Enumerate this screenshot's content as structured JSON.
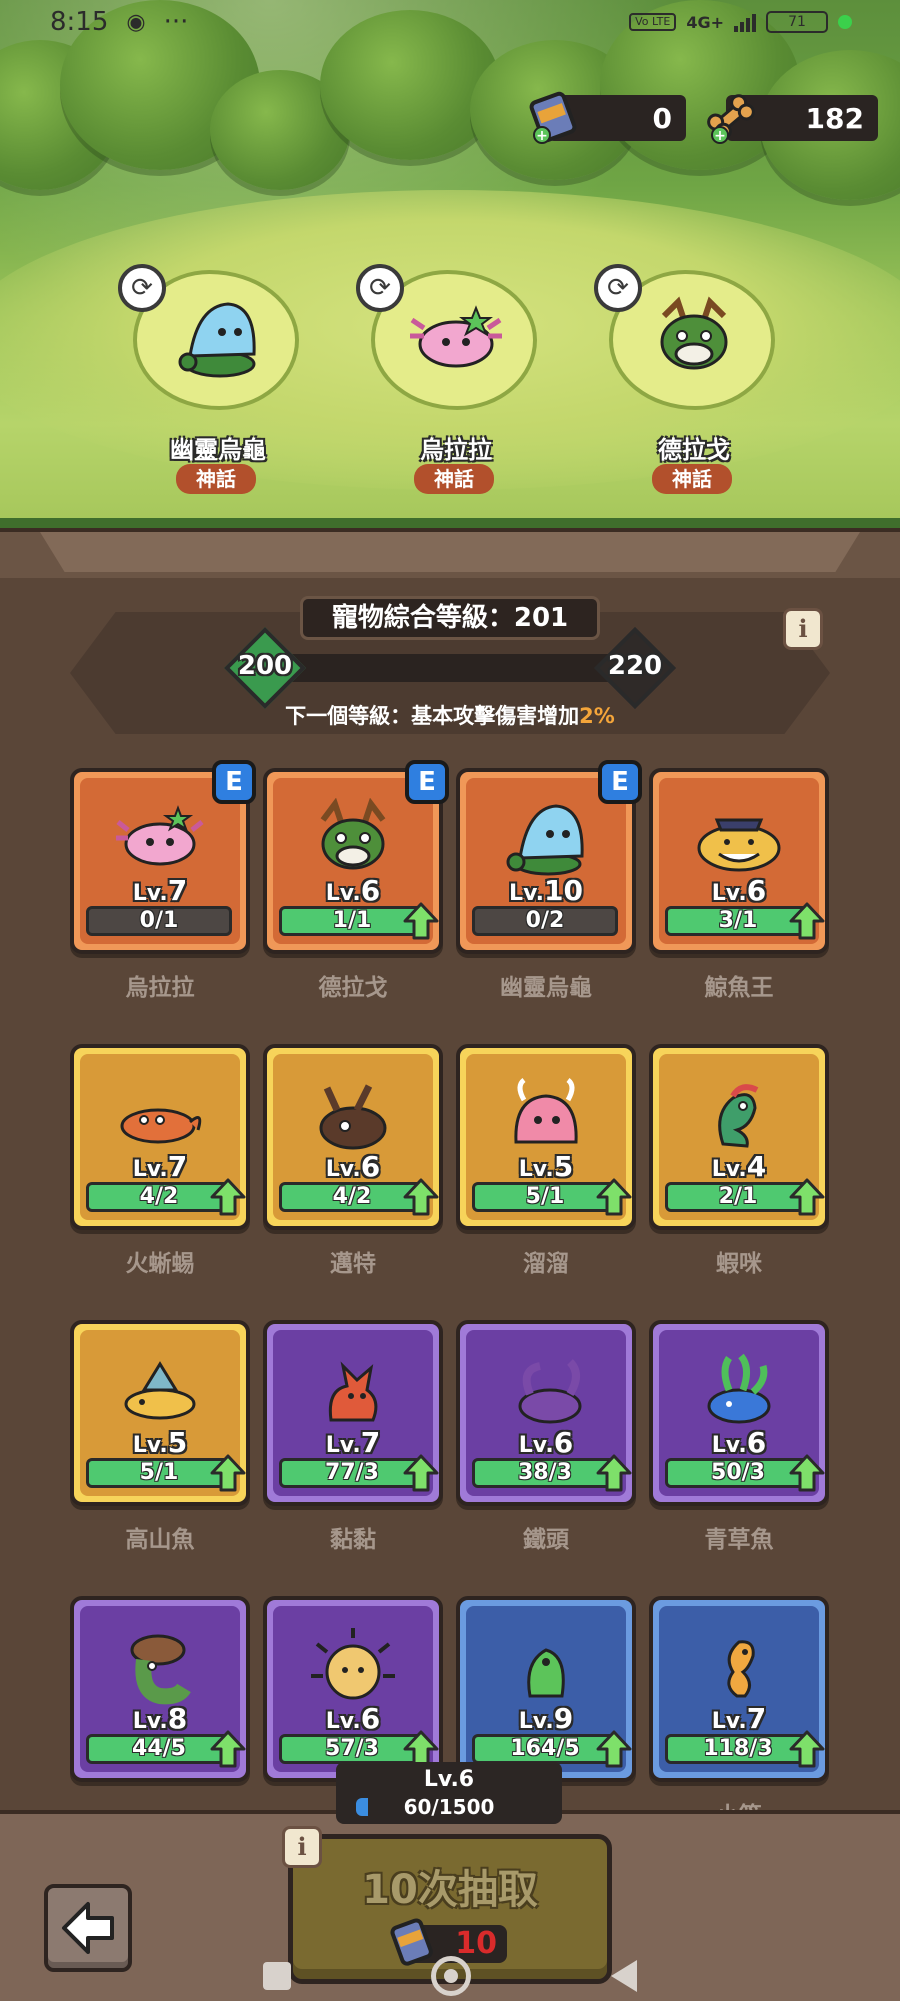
{
  "status_bar": {
    "time": "8:15",
    "network": "4G+",
    "volte": "Vo LTE",
    "battery": "71"
  },
  "currency": {
    "tickets": "0",
    "bones": "182"
  },
  "featured": [
    {
      "name": "幽靈烏龜",
      "rarity": "神話",
      "icon": "ghost-turtle-icon"
    },
    {
      "name": "烏拉拉",
      "rarity": "神話",
      "icon": "axolotl-icon"
    },
    {
      "name": "德拉戈",
      "rarity": "神話",
      "icon": "dragon-icon"
    }
  ],
  "pet_level": {
    "title": "寵物綜合等級：201",
    "current": "200",
    "next": "220",
    "progress": 0.05,
    "next_bonus_prefix": "下一個等級：基本攻擊傷害增加",
    "next_bonus_value": "2%"
  },
  "pets": [
    {
      "name": "烏拉拉",
      "level_prefix": "Lv.",
      "level": "7",
      "progress": "0/1",
      "ready": false,
      "equipped": true,
      "equip_label": "E",
      "rarity": "mythic",
      "icon": "axolotl-icon"
    },
    {
      "name": "德拉戈",
      "level_prefix": "Lv.",
      "level": "6",
      "progress": "1/1",
      "ready": true,
      "equipped": true,
      "equip_label": "E",
      "rarity": "mythic",
      "icon": "dragon-icon"
    },
    {
      "name": "幽靈烏龜",
      "level_prefix": "Lv.",
      "level": "10",
      "progress": "0/2",
      "ready": false,
      "equipped": true,
      "equip_label": "E",
      "rarity": "mythic",
      "icon": "ghost-turtle-icon"
    },
    {
      "name": "鯨魚王",
      "level_prefix": "Lv.",
      "level": "6",
      "progress": "3/1",
      "ready": true,
      "equipped": false,
      "rarity": "mythic",
      "icon": "whale-king-icon"
    },
    {
      "name": "火蜥蜴",
      "level_prefix": "Lv.",
      "level": "7",
      "progress": "4/2",
      "ready": true,
      "equipped": false,
      "rarity": "legend",
      "icon": "salamander-icon"
    },
    {
      "name": "邁特",
      "level_prefix": "Lv.",
      "level": "6",
      "progress": "4/2",
      "ready": true,
      "equipped": false,
      "rarity": "legend",
      "icon": "beetle-icon"
    },
    {
      "name": "溜溜",
      "level_prefix": "Lv.",
      "level": "5",
      "progress": "5/1",
      "ready": true,
      "equipped": false,
      "rarity": "legend",
      "icon": "pink-slime-icon"
    },
    {
      "name": "蝦咪",
      "level_prefix": "Lv.",
      "level": "4",
      "progress": "2/1",
      "ready": true,
      "equipped": false,
      "rarity": "legend",
      "icon": "sea-dragon-icon"
    },
    {
      "name": "高山魚",
      "level_prefix": "Lv.",
      "level": "5",
      "progress": "5/1",
      "ready": true,
      "equipped": false,
      "rarity": "legend",
      "icon": "mountain-fish-icon"
    },
    {
      "name": "黏黏",
      "level_prefix": "Lv.",
      "level": "7",
      "progress": "77/3",
      "ready": true,
      "equipped": false,
      "rarity": "epic",
      "icon": "red-fox-icon"
    },
    {
      "name": "鐵頭",
      "level_prefix": "Lv.",
      "level": "6",
      "progress": "38/3",
      "ready": true,
      "equipped": false,
      "rarity": "epic",
      "icon": "iron-head-icon"
    },
    {
      "name": "青草魚",
      "level_prefix": "Lv.",
      "level": "6",
      "progress": "50/3",
      "ready": true,
      "equipped": false,
      "rarity": "epic",
      "icon": "grass-fish-icon"
    },
    {
      "name": "",
      "level_prefix": "Lv.",
      "level": "8",
      "progress": "44/5",
      "ready": true,
      "equipped": false,
      "rarity": "epic",
      "icon": "mushroom-worm-icon"
    },
    {
      "name": "",
      "level_prefix": "Lv.",
      "level": "6",
      "progress": "57/3",
      "ready": true,
      "equipped": false,
      "rarity": "epic",
      "icon": "puffer-fish-icon"
    },
    {
      "name": "",
      "level_prefix": "Lv.",
      "level": "9",
      "progress": "164/5",
      "ready": true,
      "equipped": false,
      "rarity": "rare",
      "icon": "green-frog-icon"
    },
    {
      "name": "小篇",
      "level_prefix": "Lv.",
      "level": "7",
      "progress": "118/3",
      "ready": true,
      "equipped": false,
      "rarity": "rare",
      "icon": "seahorse-icon"
    }
  ],
  "player": {
    "level": "Lv.6",
    "xp": "60/1500",
    "xp_fraction": 0.04
  },
  "draw": {
    "label": "10次抽取",
    "cost": "10"
  },
  "icons": {
    "info": "i",
    "back": "back-arrow-icon"
  }
}
